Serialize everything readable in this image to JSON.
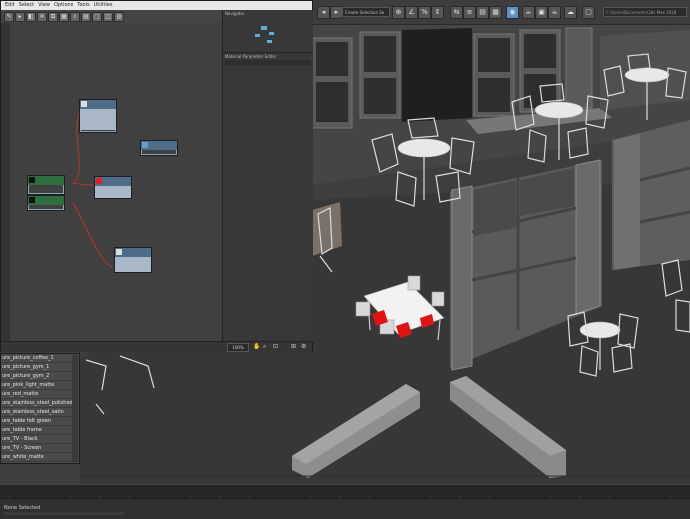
{
  "slate": {
    "menu": [
      "Edit",
      "Select",
      "View",
      "Options",
      "Tools",
      "Utilities"
    ],
    "navigator_title": "Navigator",
    "param_title": "Material Parameter Editor",
    "zoom_value": "100%"
  },
  "toolbar": {
    "selection_set": "Create Selection Se",
    "project_path": "C:\\Users\\Documents\\3ds Max 2018"
  },
  "materials": [
    "ure_picture_coffee_1",
    "ure_picture_gym_1",
    "ure_picture_gym_2",
    "ure_pink_light_matte",
    "ure_red_matte",
    "ure_stainless_steel_polished",
    "ure_stainless_steel_satin",
    "ure_table felt green",
    "ure_table frame",
    "ure_TV - Black",
    "ure_TV - Screen",
    "ure_white_matte"
  ],
  "status": {
    "selection": "None Selected"
  },
  "colors": {
    "node_header": "#4e6d88",
    "node_body": "#a8b8c8",
    "wire": "#c03030",
    "accent_blue": "#5a8fc8"
  }
}
